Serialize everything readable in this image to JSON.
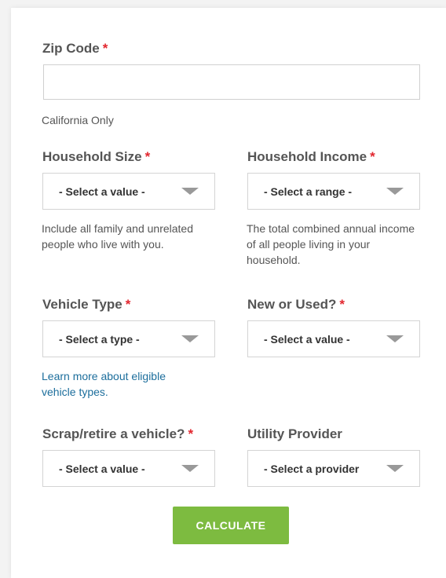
{
  "form": {
    "zip": {
      "label": "Zip Code",
      "required_mark": "*",
      "value": "",
      "help": "California Only"
    },
    "household_size": {
      "label": "Household Size",
      "required_mark": "*",
      "select_value": "- Select a value -",
      "help": "Include all family and unrelated people who live with you."
    },
    "household_income": {
      "label": "Household Income",
      "required_mark": "*",
      "select_value": "- Select a range -",
      "help": "The total combined annual income of all people living in your household."
    },
    "vehicle_type": {
      "label": "Vehicle Type",
      "required_mark": "*",
      "select_value": "- Select a type -",
      "link": "Learn more about eligible vehicle types."
    },
    "new_or_used": {
      "label": "New or Used?",
      "required_mark": "*",
      "select_value": "- Select a value -"
    },
    "scrap": {
      "label": "Scrap/retire a vehicle?",
      "required_mark": "*",
      "select_value": "- Select a value -"
    },
    "utility": {
      "label": "Utility Provider",
      "select_value": "- Select a provider"
    },
    "calculate_label": "CALCULATE"
  },
  "colors": {
    "required": "#e2262e",
    "link": "#1c6e9c",
    "button": "#7dbb40"
  },
  "icons": {
    "select_caret": "caret-down-icon"
  }
}
